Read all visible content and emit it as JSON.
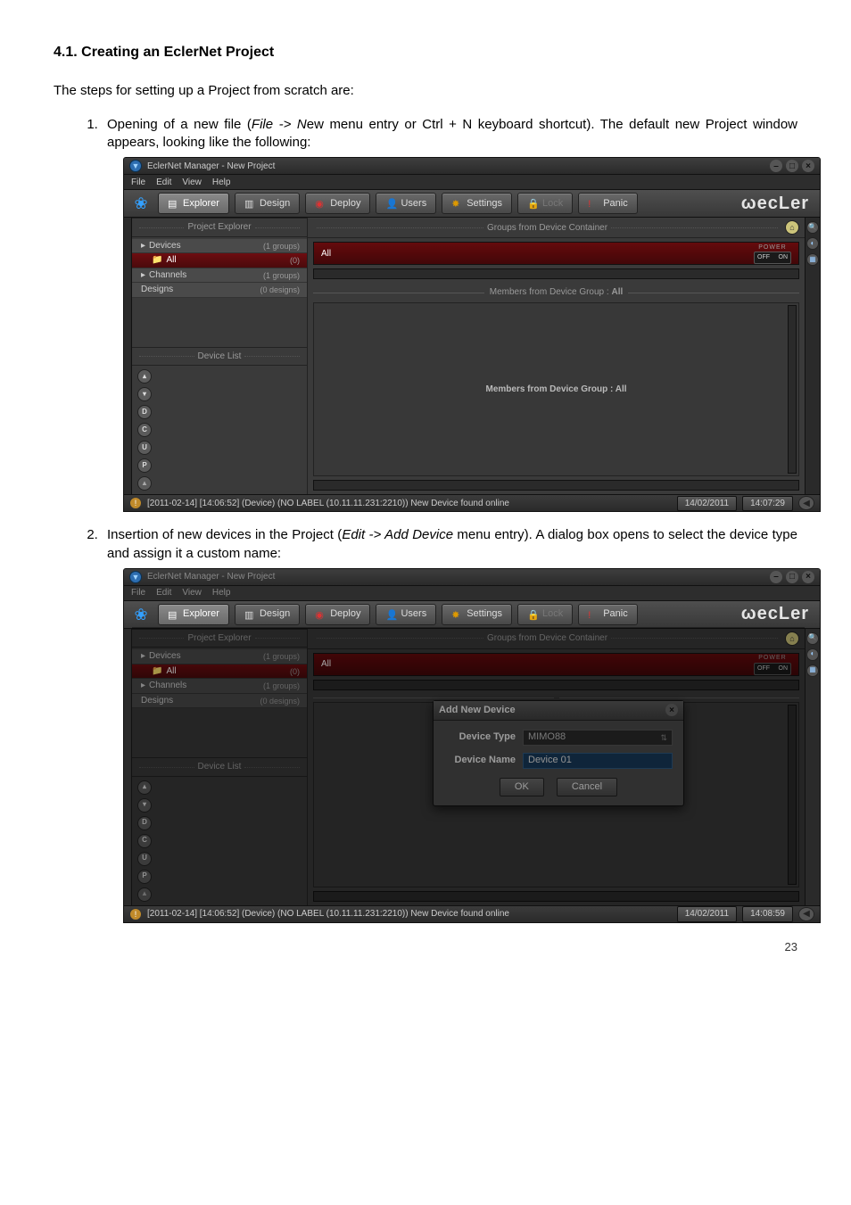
{
  "doc": {
    "heading": "4.1. Creating an EclerNet Project",
    "intro": "The steps for setting up a Project from scratch are:",
    "step1_a": "Opening of a new file (",
    "step1_i": "File -> N",
    "step1_b": "ew menu entry or Ctrl + N keyboard shortcut). The default new Project window appears, looking like the following:",
    "step2_a": "Insertion of new devices in the Project (",
    "step2_i": "Edit -> Add Device",
    "step2_b": " menu entry). A dialog box opens to select the device type and assign it a custom name:",
    "page": "23"
  },
  "app": {
    "title": "EclerNet Manager - New Project",
    "menus": [
      "File",
      "Edit",
      "View",
      "Help"
    ],
    "brand": "ecLer",
    "toolbar": {
      "explorer": "Explorer",
      "design": "Design",
      "deploy": "Deploy",
      "users": "Users",
      "settings": "Settings",
      "lock": "Lock",
      "panic": "Panic"
    },
    "sidebar": {
      "project_explorer": "Project Explorer",
      "devices": "Devices",
      "devices_cnt": "(1 groups)",
      "all": "All",
      "all_cnt": "(0)",
      "channels": "Channels",
      "channels_cnt": "(1 groups)",
      "designs": "Designs",
      "designs_cnt": "(0 designs)",
      "device_list": "Device List",
      "btn_d": "D",
      "btn_c": "C",
      "btn_u": "U",
      "btn_p": "P"
    },
    "content": {
      "groups_title": "Groups from Device Container",
      "all_bar": "All",
      "power_label": "POWER",
      "power_off": "OFF",
      "power_on": "ON",
      "members_title_prefix": "Members from Device Group :",
      "members_title_name": "All",
      "members_placeholder": "Members from Device Group : All"
    },
    "status": {
      "msg": "[2011-02-14] [14:06:52] (Device) (NO LABEL (10.11.11.231:2210)) New Device found online",
      "date": "14/02/2011",
      "time1": "14:07:29",
      "time2": "14:08:59"
    },
    "dialog": {
      "title": "Add New Device",
      "type_label": "Device Type",
      "type_value": "MIMO88",
      "name_label": "Device Name",
      "name_value": "Device 01",
      "ok": "OK",
      "cancel": "Cancel"
    }
  }
}
